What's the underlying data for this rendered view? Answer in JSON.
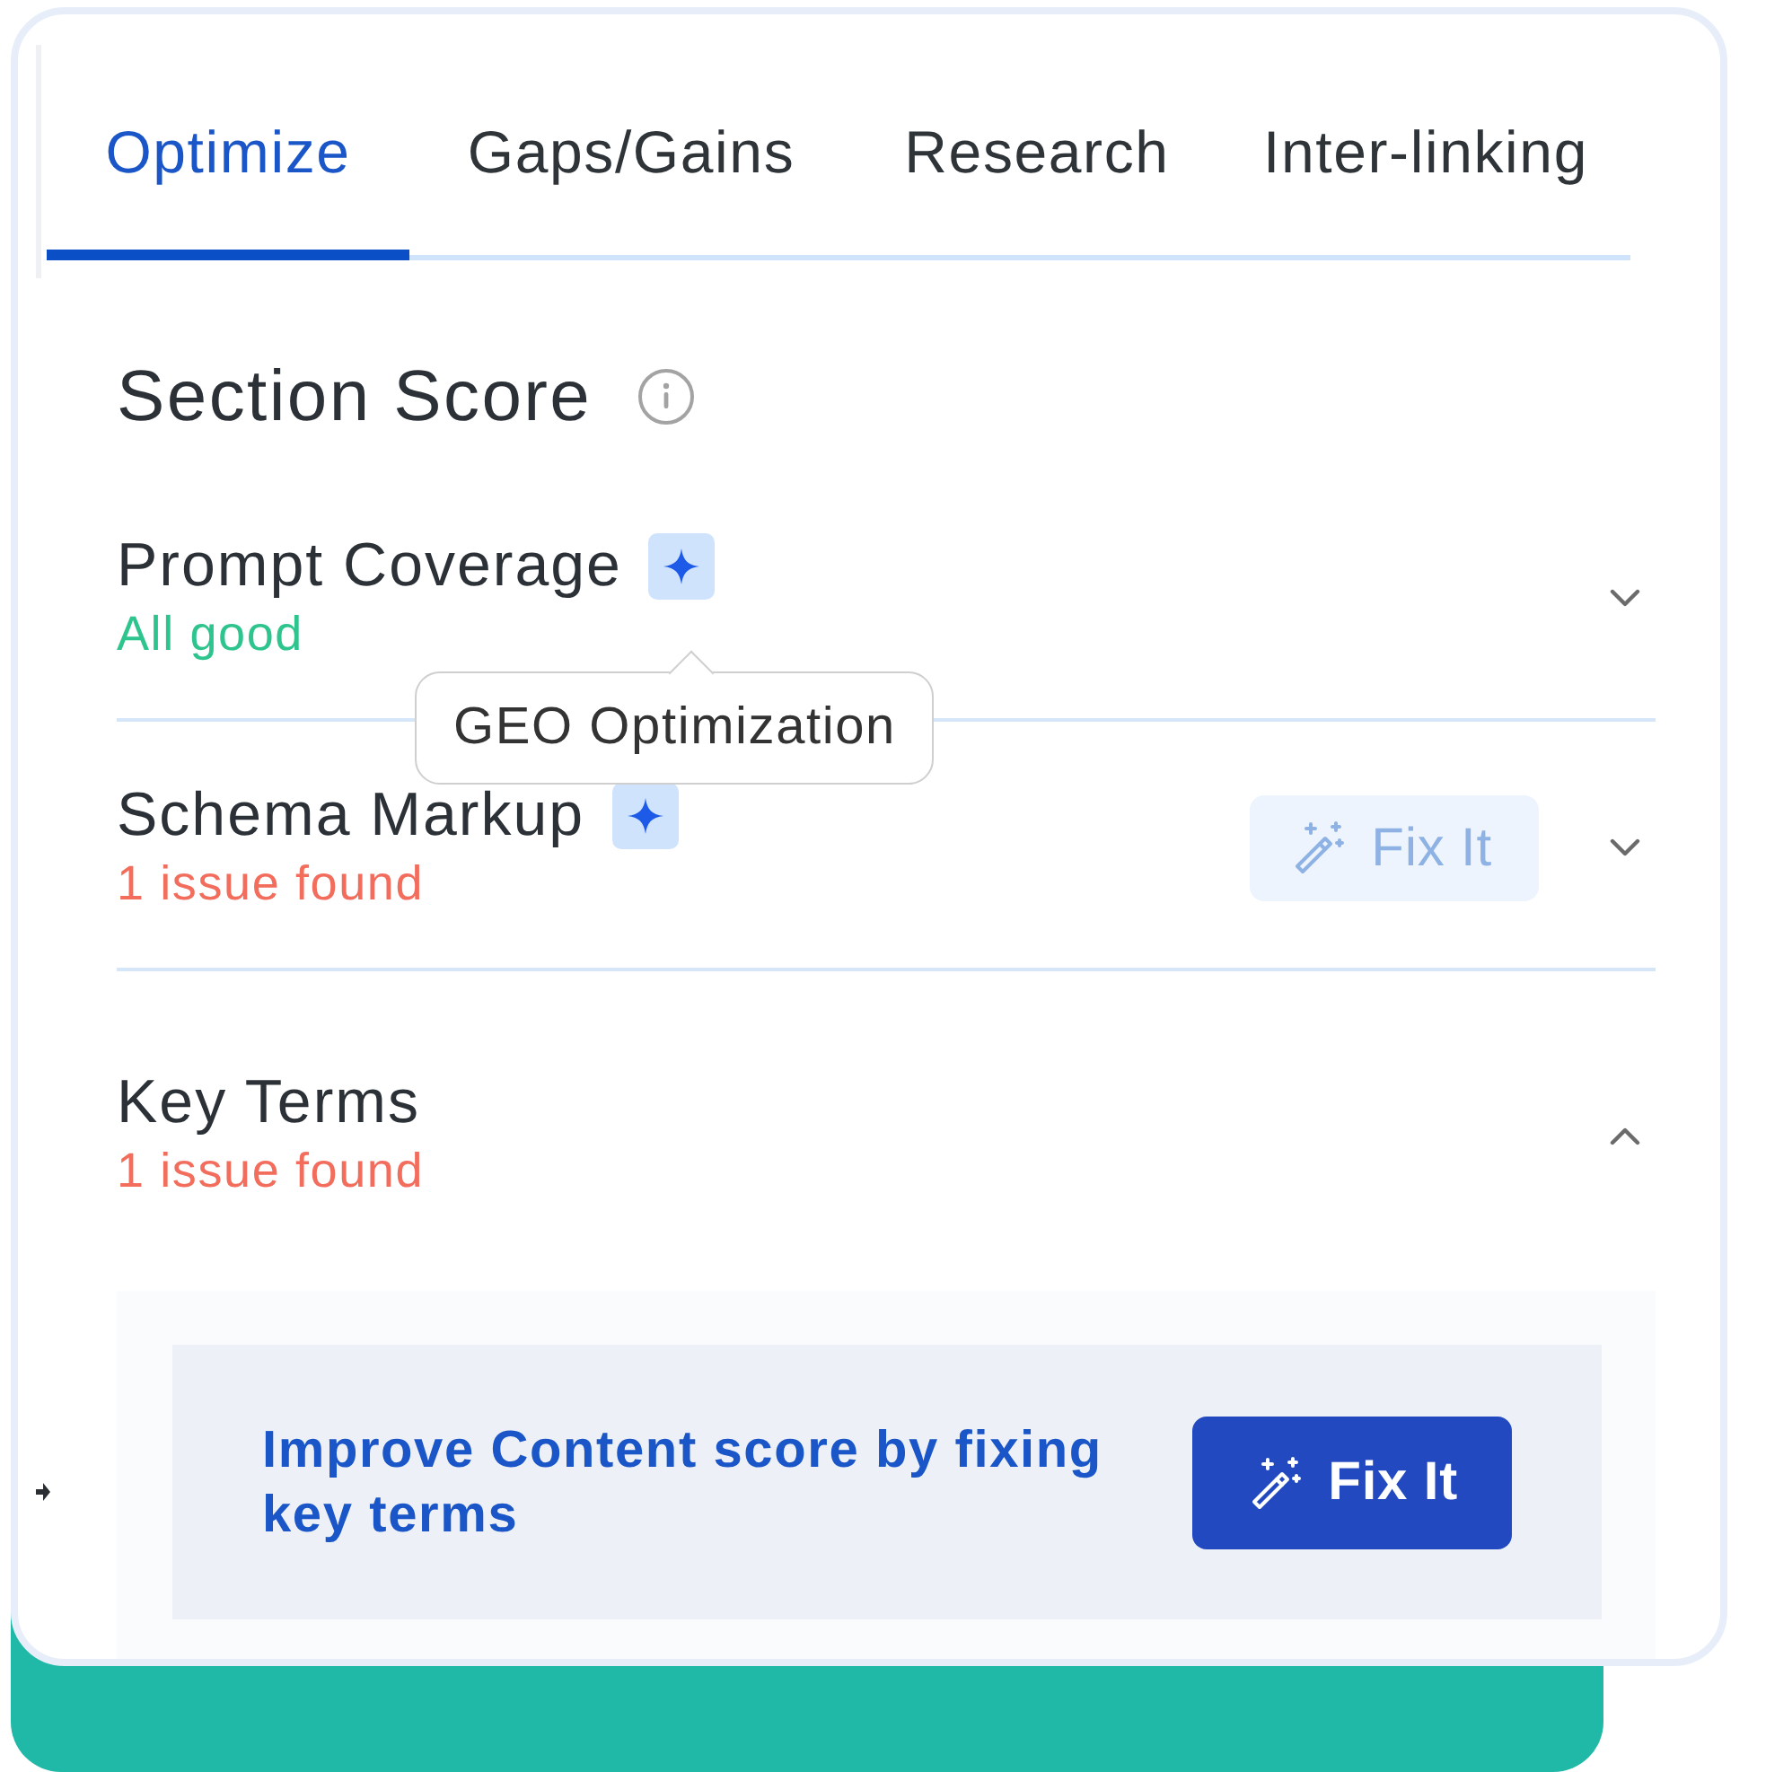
{
  "tabs": [
    {
      "label": "Optimize",
      "selected": true
    },
    {
      "label": "Gaps/Gains",
      "selected": false
    },
    {
      "label": "Research",
      "selected": false
    },
    {
      "label": "Inter-linking",
      "selected": false
    }
  ],
  "section_score": {
    "title": "Section Score"
  },
  "sections": [
    {
      "title": "Prompt Coverage",
      "ai_badge": true,
      "tooltip": "GEO Optimization",
      "status": {
        "text": "All good",
        "kind": "good"
      },
      "expanded": false
    },
    {
      "title": "Schema Markup",
      "ai_badge": true,
      "status": {
        "text": "1 issue found",
        "kind": "issue"
      },
      "fix_button": {
        "label": "Fix It",
        "disabled": true
      },
      "expanded": false
    },
    {
      "title": "Key Terms",
      "ai_badge": false,
      "status": {
        "text": "1 issue found",
        "kind": "issue"
      },
      "expanded": true,
      "detail": {
        "text": "Improve Content score by fixing key terms",
        "fix_button": {
          "label": "Fix It",
          "disabled": false
        }
      }
    }
  ]
}
